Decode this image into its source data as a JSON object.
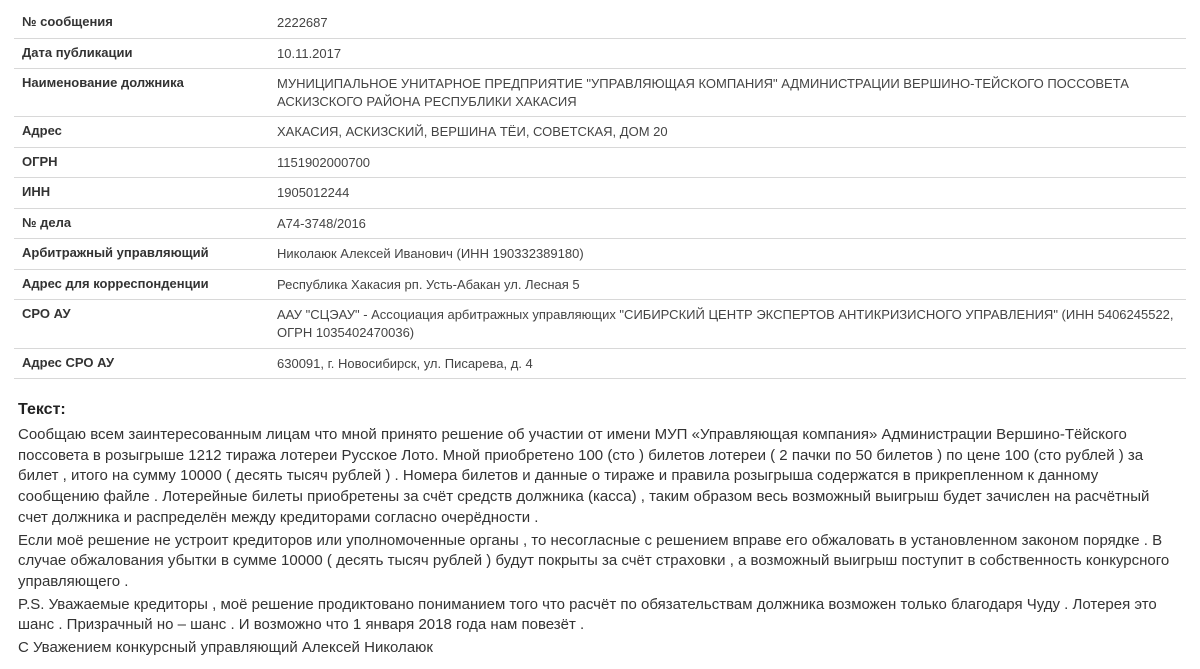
{
  "table": {
    "rows": [
      {
        "label": "№ сообщения",
        "value": "2222687"
      },
      {
        "label": "Дата публикации",
        "value": "10.11.2017"
      },
      {
        "label": "Наименование должника",
        "value": "МУНИЦИПАЛЬНОЕ УНИТАРНОЕ ПРЕДПРИЯТИЕ \"УПРАВЛЯЮЩАЯ КОМПАНИЯ\" АДМИНИСТРАЦИИ ВЕРШИНО-ТЕЙСКОГО ПОССОВЕТА АСКИЗСКОГО РАЙОНА РЕСПУБЛИКИ ХАКАСИЯ"
      },
      {
        "label": "Адрес",
        "value": "ХАКАСИЯ, АСКИЗСКИЙ, ВЕРШИНА ТЁИ, СОВЕТСКАЯ, ДОМ 20"
      },
      {
        "label": "ОГРН",
        "value": "1151902000700"
      },
      {
        "label": "ИНН",
        "value": "1905012244"
      },
      {
        "label": "№ дела",
        "value": "А74-3748/2016"
      },
      {
        "label": "Арбитражный управляющий",
        "value": "Николаюк Алексей Иванович (ИНН 190332389180)"
      },
      {
        "label": "Адрес для корреспонденции",
        "value": "Республика Хакасия рп. Усть-Абакан ул. Лесная 5"
      },
      {
        "label": "СРО АУ",
        "value": "ААУ \"СЦЭАУ\" - Ассоциация арбитражных управляющих \"СИБИРСКИЙ ЦЕНТР ЭКСПЕРТОВ АНТИКРИЗИСНОГО УПРАВЛЕНИЯ\" (ИНН 5406245522, ОГРН 1035402470036)"
      },
      {
        "label": "Адрес СРО АУ",
        "value": "630091, г. Новосибирск, ул. Писарева, д. 4"
      }
    ]
  },
  "text": {
    "heading": "Текст:",
    "paragraphs": [
      "Сообщаю всем заинтересованным лицам что мной принято решение об участии от имени МУП «Управляющая компания» Администрации Вершино-Тёйского поссовета в розыгрыше 1212 тиража лотереи Русское Лото. Мной приобретено 100 (сто ) билетов лотереи ( 2 пачки по 50 билетов ) по цене 100 (сто рублей ) за билет , итого на сумму 10000 ( десять тысяч рублей ) . Номера билетов и данные о тираже и правила розыгрыша содержатся в прикрепленном к данному сообщению файле . Лотерейные билеты приобретены за счёт средств должника (касса) , таким образом весь возможный выигрыш будет зачислен на расчётный счет должника и распределён между кредиторами согласно очерёдности .",
      "Если моё решение не устроит кредиторов или уполномоченные органы , то несогласные с решением вправе его обжаловать в установленном законом порядке . В случае обжалования убытки в сумме 10000 ( десять тысяч рублей ) будут покрыты за счёт страховки , а возможный выигрыш поступит в собственность конкурсного управляющего .",
      "P.S. Уважаемые кредиторы , моё решение продиктовано пониманием того что расчёт по обязательствам должника возможен только благодаря Чуду . Лотерея это шанс . Призрачный но – шанс . И возможно что 1 января 2018 года нам повезёт .",
      "С Уважением   конкурсный управляющий Алексей Николаюк"
    ]
  }
}
